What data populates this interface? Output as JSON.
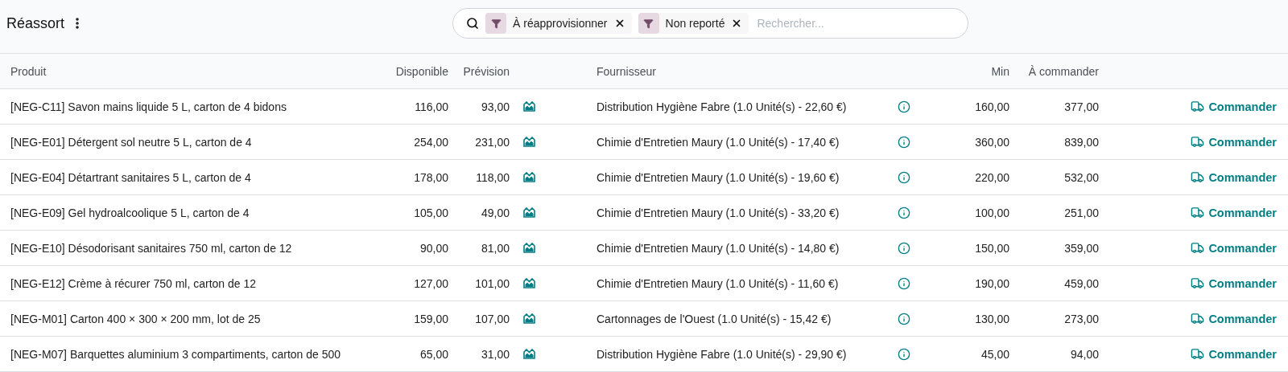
{
  "header": {
    "title": "Réassort"
  },
  "search": {
    "facets": [
      {
        "label": "À réapprovisionner"
      },
      {
        "label": "Non reporté"
      }
    ],
    "placeholder": "Rechercher..."
  },
  "columns": {
    "product": "Produit",
    "available": "Disponible",
    "forecast": "Prévision",
    "supplier": "Fournisseur",
    "min": "Min",
    "to_order": "À commander"
  },
  "rows": [
    {
      "product": "[NEG-C11] Savon mains liquide 5 L, carton de 4 bidons",
      "available": "116,00",
      "forecast": "93,00",
      "supplier": "Distribution Hygiène Fabre (1.0 Unité(s) - 22,60 €)",
      "min": "160,00",
      "to_order": "377,00",
      "action": "Commander"
    },
    {
      "product": "[NEG-E01] Détergent sol neutre 5 L, carton de 4",
      "available": "254,00",
      "forecast": "231,00",
      "supplier": "Chimie d'Entretien Maury (1.0 Unité(s) - 17,40 €)",
      "min": "360,00",
      "to_order": "839,00",
      "action": "Commander"
    },
    {
      "product": "[NEG-E04] Détartrant sanitaires 5 L, carton de 4",
      "available": "178,00",
      "forecast": "118,00",
      "supplier": "Chimie d'Entretien Maury (1.0 Unité(s) - 19,60 €)",
      "min": "220,00",
      "to_order": "532,00",
      "action": "Commander"
    },
    {
      "product": "[NEG-E09] Gel hydroalcoolique 5 L, carton de 4",
      "available": "105,00",
      "forecast": "49,00",
      "supplier": "Chimie d'Entretien Maury (1.0 Unité(s) - 33,20 €)",
      "min": "100,00",
      "to_order": "251,00",
      "action": "Commander"
    },
    {
      "product": "[NEG-E10] Désodorisant sanitaires 750 ml, carton de 12",
      "available": "90,00",
      "forecast": "81,00",
      "supplier": "Chimie d'Entretien Maury (1.0 Unité(s) - 14,80 €)",
      "min": "150,00",
      "to_order": "359,00",
      "action": "Commander"
    },
    {
      "product": "[NEG-E12] Crème à récurer 750 ml, carton de 12",
      "available": "127,00",
      "forecast": "101,00",
      "supplier": "Chimie d'Entretien Maury (1.0 Unité(s) - 11,60 €)",
      "min": "190,00",
      "to_order": "459,00",
      "action": "Commander"
    },
    {
      "product": "[NEG-M01] Carton 400 × 300 × 200 mm, lot de 25",
      "available": "159,00",
      "forecast": "107,00",
      "supplier": "Cartonnages de l'Ouest (1.0 Unité(s) - 15,42 €)",
      "min": "130,00",
      "to_order": "273,00",
      "action": "Commander"
    },
    {
      "product": "[NEG-M07] Barquettes aluminium 3 compartiments, carton de 500",
      "available": "65,00",
      "forecast": "31,00",
      "supplier": "Distribution Hygiène Fabre (1.0 Unité(s) - 29,90 €)",
      "min": "45,00",
      "to_order": "94,00",
      "action": "Commander"
    }
  ]
}
